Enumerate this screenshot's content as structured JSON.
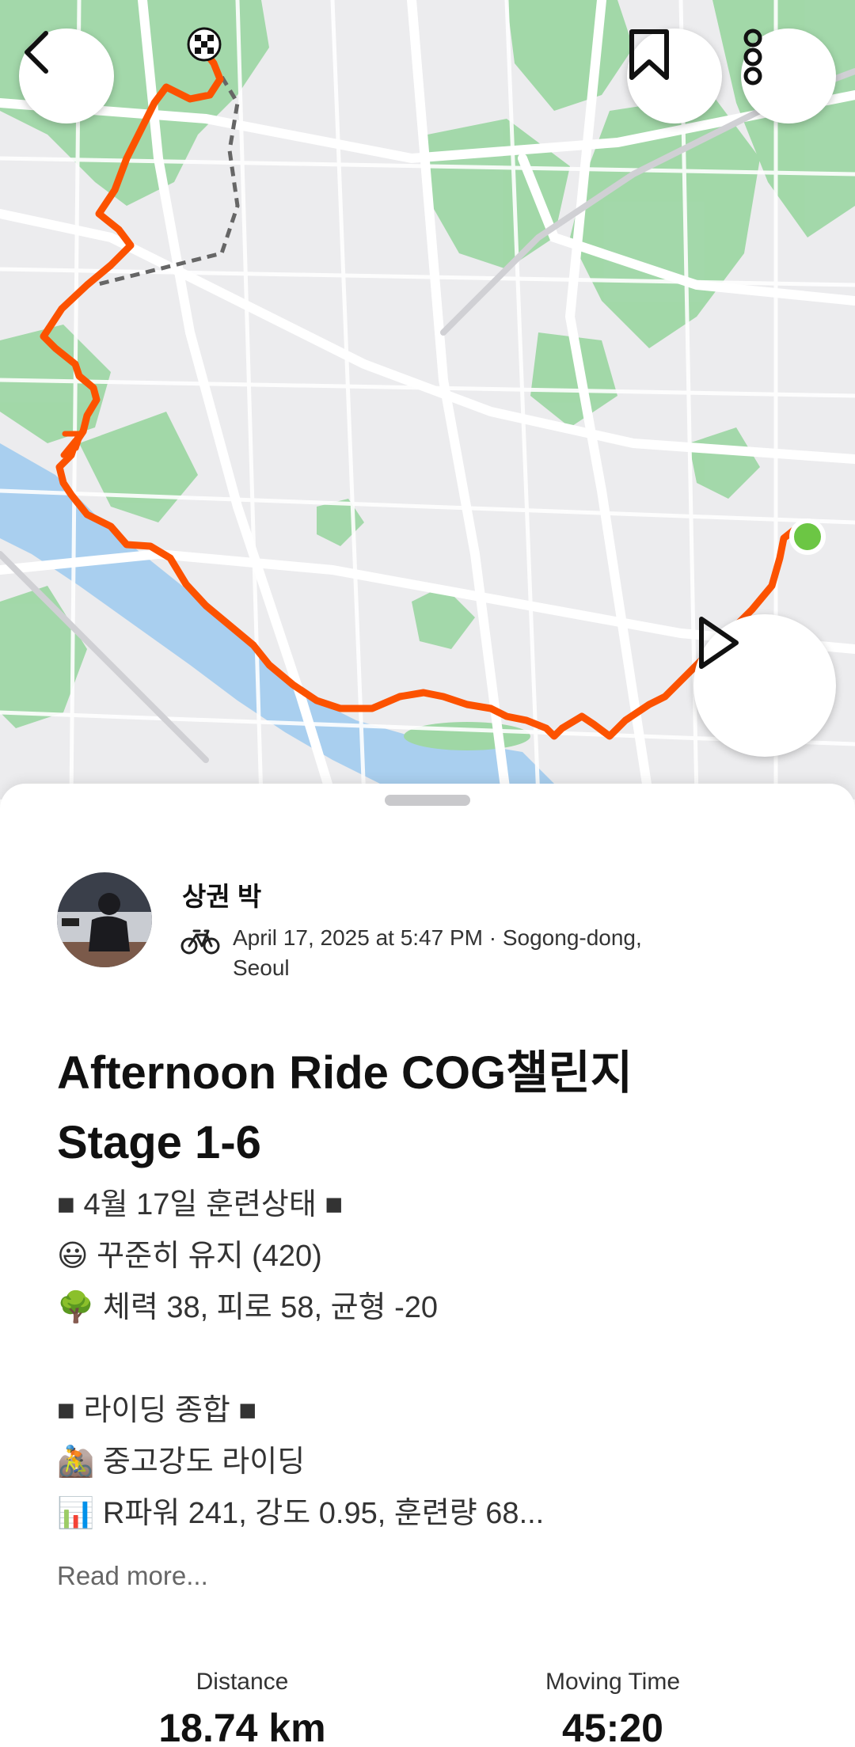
{
  "map": {
    "route_color": "#fc5200",
    "start_marker_color": "#6cc644",
    "water_color": "#a9cfef",
    "park_color": "#8fd19a"
  },
  "controls": {
    "back_icon": "chevron-left-icon",
    "bookmark_icon": "bookmark-icon",
    "more_icon": "more-vertical-icon",
    "play_icon": "play-icon"
  },
  "activity": {
    "athlete_name": "상권 박",
    "sport_icon": "bicycle-icon",
    "date_location_line1": "April 17, 2025 at 5:47 PM · Sogong-dong,",
    "date_location_line2": "Seoul",
    "title_line1": "Afternoon Ride COG챌린지",
    "title_line2": "Stage 1-6",
    "description": [
      "■ 4월 17일 훈련상태 ■",
      "😃 꾸준히 유지 (420)",
      "🌳 체력 38, 피로 58, 균형 -20",
      "",
      "■ 라이딩 종합 ■",
      "🚵 중고강도 라이딩",
      "📊 R파워 241, 강도 0.95, 훈련량 68..."
    ],
    "read_more": "Read more...",
    "stats": [
      {
        "label": "Distance",
        "value": "18.74 km"
      },
      {
        "label": "Moving Time",
        "value": "45:20"
      }
    ]
  }
}
